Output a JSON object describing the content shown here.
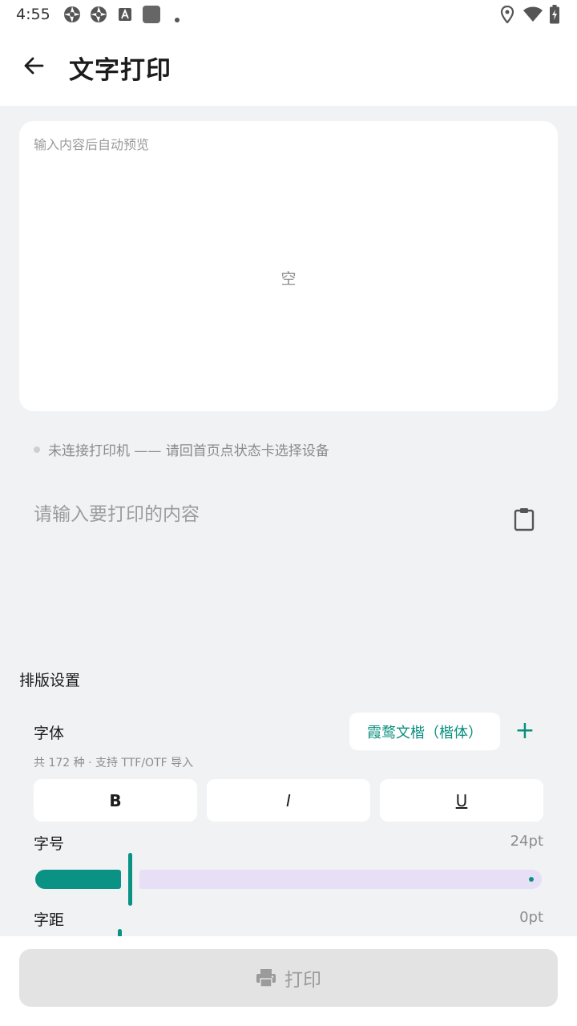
{
  "status_bar": {
    "time": "4:55",
    "icons": [
      "aperture-icon",
      "aperture-icon",
      "font-app-icon",
      "square-app-icon",
      "dot-icon",
      "location-icon",
      "wifi-icon",
      "battery-charging-icon"
    ]
  },
  "app_bar": {
    "title": "文字打印",
    "back_icon": "arrow-left-icon"
  },
  "preview": {
    "hint": "输入内容后自动预览",
    "empty_text": "空"
  },
  "connection": {
    "status_text": "未连接打印机 —— 请回首页点状态卡选择设备"
  },
  "input": {
    "value": "",
    "placeholder": "请输入要打印的内容",
    "paste_icon": "clipboard-icon"
  },
  "layout_settings": {
    "title": "排版设置",
    "font": {
      "label": "字体",
      "selected": "霞鹜文楷（楷体）",
      "add_label": "+",
      "count_text": "共 172 种 · 支持 TTF/OTF 导入"
    },
    "styles": {
      "bold": "B",
      "italic": "I",
      "underline": "U"
    },
    "size": {
      "label": "字号",
      "value_text": "24pt",
      "fraction": 0.2
    },
    "spacing": {
      "label": "字距",
      "value_text": "0pt"
    }
  },
  "print": {
    "label": "打印",
    "icon": "printer-icon"
  },
  "colors": {
    "accent": "#0a9385",
    "slider_inactive": "#e6dff6",
    "background": "#f1f2f4",
    "disabled_button": "#e3e3e3"
  }
}
